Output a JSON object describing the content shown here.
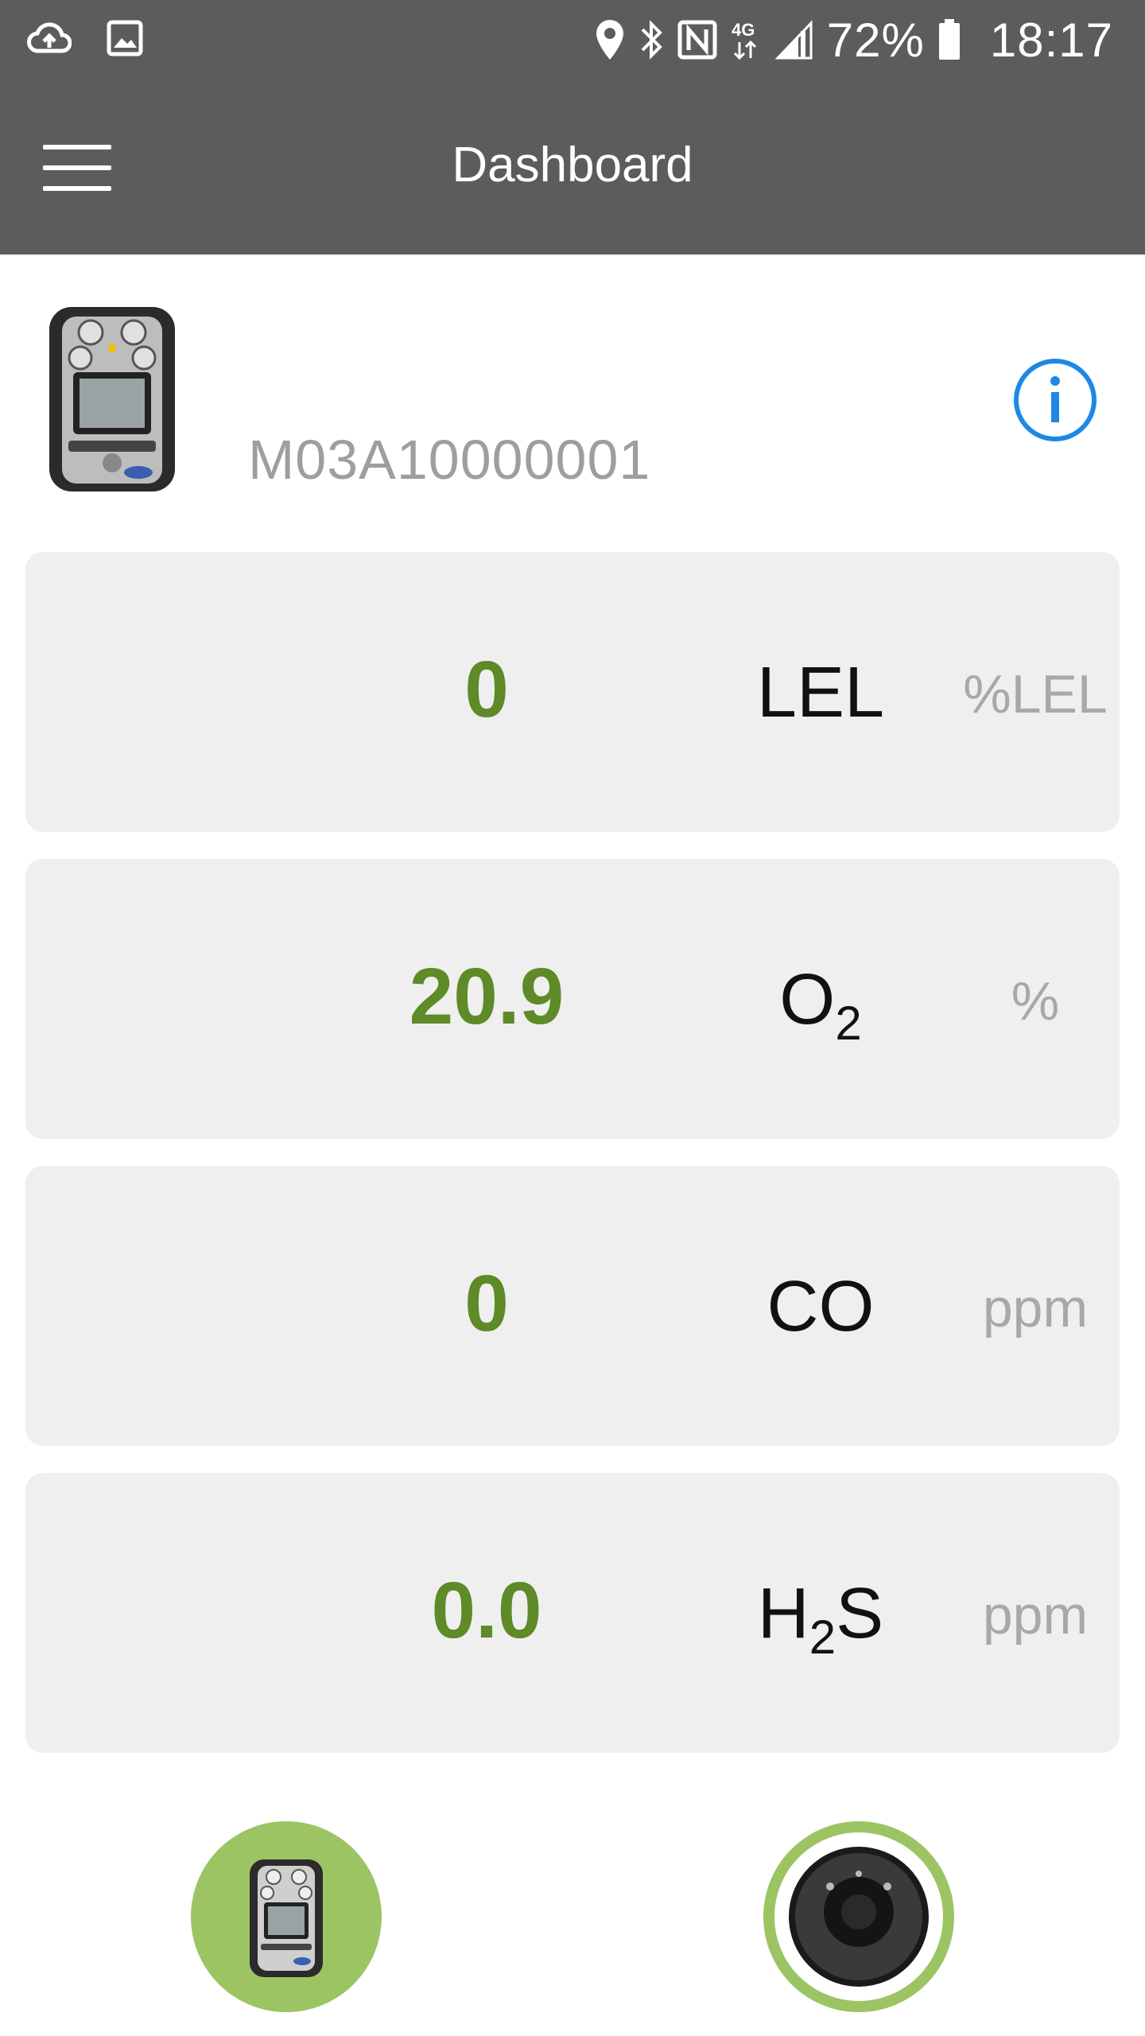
{
  "status_bar": {
    "battery_percent": "72%",
    "time": "18:17",
    "network": "4G",
    "icons": [
      "cloud-upload-icon",
      "image-icon",
      "location-pin-icon",
      "bluetooth-icon",
      "nfc-icon",
      "network-4g-icon",
      "signal-icon",
      "battery-icon"
    ]
  },
  "app_bar": {
    "title": "Dashboard",
    "menu_icon": "hamburger-menu-icon"
  },
  "device": {
    "serial": "M03A10000001",
    "info_icon": "info-icon"
  },
  "readings": [
    {
      "value": "0",
      "gas": "LEL",
      "gas_sub": "",
      "gas_suffix": "",
      "unit": "%LEL"
    },
    {
      "value": "20.9",
      "gas": "O",
      "gas_sub": "2",
      "gas_suffix": "",
      "unit": "%"
    },
    {
      "value": "0",
      "gas": "CO",
      "gas_sub": "",
      "gas_suffix": "",
      "unit": "ppm"
    },
    {
      "value": "0.0",
      "gas": "H",
      "gas_sub": "2",
      "gas_suffix": "S",
      "unit": "ppm"
    }
  ],
  "bottom_nav": {
    "left_button": "multi-gas-device-button",
    "right_button": "zephyr-device-button"
  },
  "colors": {
    "bar_bg": "#5c5c5c",
    "value_green": "#5e8a27",
    "button_green": "#9cc463",
    "card_bg": "#efefef",
    "info_blue": "#1e88e5"
  }
}
